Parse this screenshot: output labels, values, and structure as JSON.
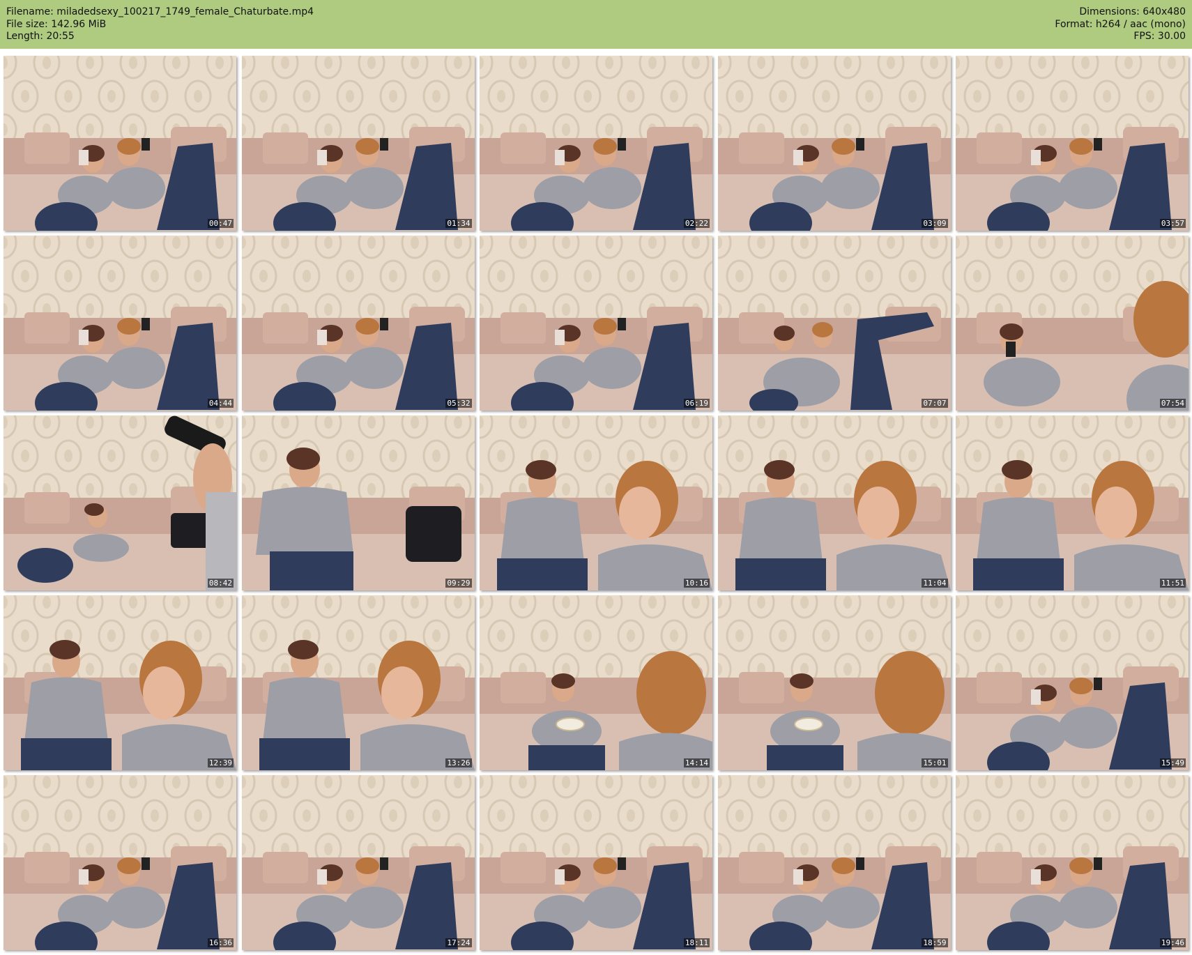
{
  "header": {
    "filename": "Filename: miladedsexy_100217_1749_female_Chaturbate.mp4",
    "file_size": "File size: 142.96 MiB",
    "length": "Length: 20:55",
    "dimensions": "Dimensions: 640x480",
    "format": "Format: h264 / aac (mono)",
    "fps": "FPS: 30.00"
  },
  "colors": {
    "header_bg": "#aecb80",
    "wall": "#e9dccb",
    "wall_pattern": "#cfbfa8",
    "sofa": "#c9a597",
    "denim": "#2f3c5c",
    "shirt": "#9e9ea6",
    "skin": "#d9a98a",
    "hair_dark": "#5a3426",
    "hair_light": "#b9763f"
  },
  "thumbnails": [
    {
      "time": "00:47",
      "scene": "lying-phones",
      "icon": "video-frame-thumbnail"
    },
    {
      "time": "01:34",
      "scene": "lying-phones",
      "icon": "video-frame-thumbnail"
    },
    {
      "time": "02:22",
      "scene": "lying-phones",
      "icon": "video-frame-thumbnail"
    },
    {
      "time": "03:09",
      "scene": "lying-phones",
      "icon": "video-frame-thumbnail"
    },
    {
      "time": "03:57",
      "scene": "lying-phones",
      "icon": "video-frame-thumbnail"
    },
    {
      "time": "04:44",
      "scene": "lying-phones",
      "icon": "video-frame-thumbnail"
    },
    {
      "time": "05:32",
      "scene": "lying-phones",
      "icon": "video-frame-thumbnail"
    },
    {
      "time": "06:19",
      "scene": "lying-phones",
      "icon": "video-frame-thumbnail"
    },
    {
      "time": "07:07",
      "scene": "legs-up",
      "icon": "video-frame-thumbnail"
    },
    {
      "time": "07:54",
      "scene": "closeup-right",
      "icon": "video-frame-thumbnail"
    },
    {
      "time": "08:42",
      "scene": "hand-phone",
      "icon": "video-frame-thumbnail"
    },
    {
      "time": "09:29",
      "scene": "sitting-one",
      "icon": "video-frame-thumbnail"
    },
    {
      "time": "10:16",
      "scene": "sitting-two",
      "icon": "video-frame-thumbnail"
    },
    {
      "time": "11:04",
      "scene": "sitting-two",
      "icon": "video-frame-thumbnail"
    },
    {
      "time": "11:51",
      "scene": "sitting-two",
      "icon": "video-frame-thumbnail"
    },
    {
      "time": "12:39",
      "scene": "sitting-two",
      "icon": "video-frame-thumbnail"
    },
    {
      "time": "13:26",
      "scene": "sitting-two",
      "icon": "video-frame-thumbnail"
    },
    {
      "time": "14:14",
      "scene": "bowl-two",
      "icon": "video-frame-thumbnail"
    },
    {
      "time": "15:01",
      "scene": "bowl-two",
      "icon": "video-frame-thumbnail"
    },
    {
      "time": "15:49",
      "scene": "lying-phones",
      "icon": "video-frame-thumbnail"
    },
    {
      "time": "16:36",
      "scene": "lying-phones",
      "icon": "video-frame-thumbnail"
    },
    {
      "time": "17:24",
      "scene": "lying-phones",
      "icon": "video-frame-thumbnail"
    },
    {
      "time": "18:11",
      "scene": "lying-phones",
      "icon": "video-frame-thumbnail"
    },
    {
      "time": "18:59",
      "scene": "lying-phones",
      "icon": "video-frame-thumbnail"
    },
    {
      "time": "19:46",
      "scene": "lying-phones",
      "icon": "video-frame-thumbnail"
    }
  ]
}
